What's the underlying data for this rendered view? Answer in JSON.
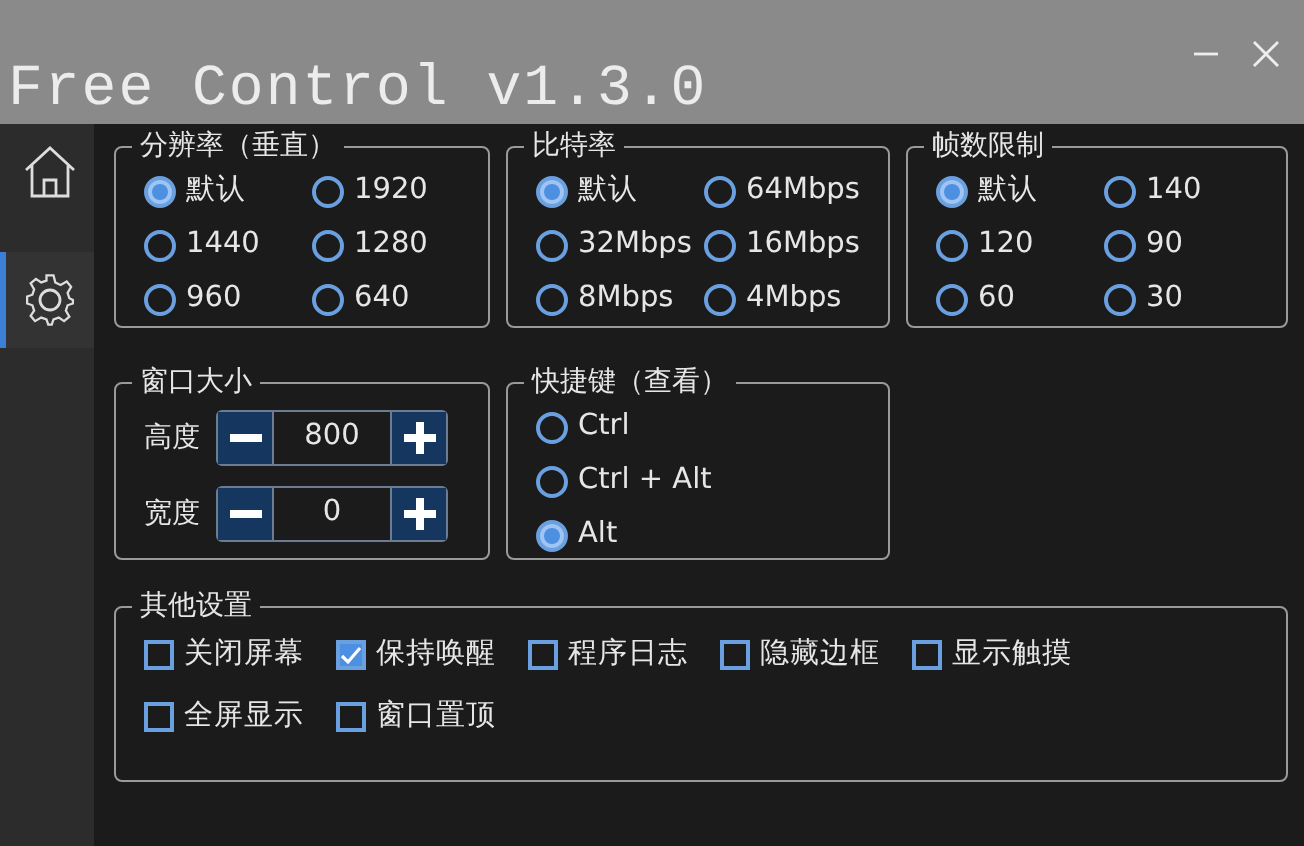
{
  "window": {
    "title": "Free Control v1.3.0"
  },
  "sidebar": {
    "items": [
      {
        "kind": "home",
        "selected": false
      },
      {
        "kind": "settings",
        "selected": true
      }
    ]
  },
  "radio_groups": [
    {
      "title": "分辨率（垂直）",
      "options": [
        {
          "label": "默认",
          "selected": true
        },
        {
          "label": "1920",
          "selected": false
        },
        {
          "label": "1440",
          "selected": false
        },
        {
          "label": "1280",
          "selected": false
        },
        {
          "label": "960",
          "selected": false
        },
        {
          "label": "640",
          "selected": false
        }
      ]
    },
    {
      "title": "比特率",
      "options": [
        {
          "label": "默认",
          "selected": true
        },
        {
          "label": "64Mbps",
          "selected": false
        },
        {
          "label": "32Mbps",
          "selected": false
        },
        {
          "label": "16Mbps",
          "selected": false
        },
        {
          "label": "8Mbps",
          "selected": false
        },
        {
          "label": "4Mbps",
          "selected": false
        }
      ]
    },
    {
      "title": "帧数限制",
      "options": [
        {
          "label": "默认",
          "selected": true
        },
        {
          "label": "140",
          "selected": false
        },
        {
          "label": "120",
          "selected": false
        },
        {
          "label": "90",
          "selected": false
        },
        {
          "label": "60",
          "selected": false
        },
        {
          "label": "30",
          "selected": false
        }
      ]
    }
  ],
  "window_size": {
    "title": "窗口大小",
    "fields": [
      {
        "label": "高度",
        "value": "800"
      },
      {
        "label": "宽度",
        "value": "0"
      }
    ]
  },
  "hotkey": {
    "title": "快捷键（查看）",
    "options": [
      {
        "label": "Ctrl",
        "selected": false
      },
      {
        "label": "Ctrl + Alt",
        "selected": false
      },
      {
        "label": "Alt",
        "selected": true
      }
    ]
  },
  "other": {
    "title": "其他设置",
    "options": [
      {
        "label": "关闭屏幕",
        "checked": false
      },
      {
        "label": "保持唤醒",
        "checked": true
      },
      {
        "label": "程序日志",
        "checked": false
      },
      {
        "label": "隐藏边框",
        "checked": false
      },
      {
        "label": "显示触摸",
        "checked": false
      },
      {
        "label": "全屏显示",
        "checked": false
      },
      {
        "label": "窗口置顶",
        "checked": false
      }
    ]
  }
}
